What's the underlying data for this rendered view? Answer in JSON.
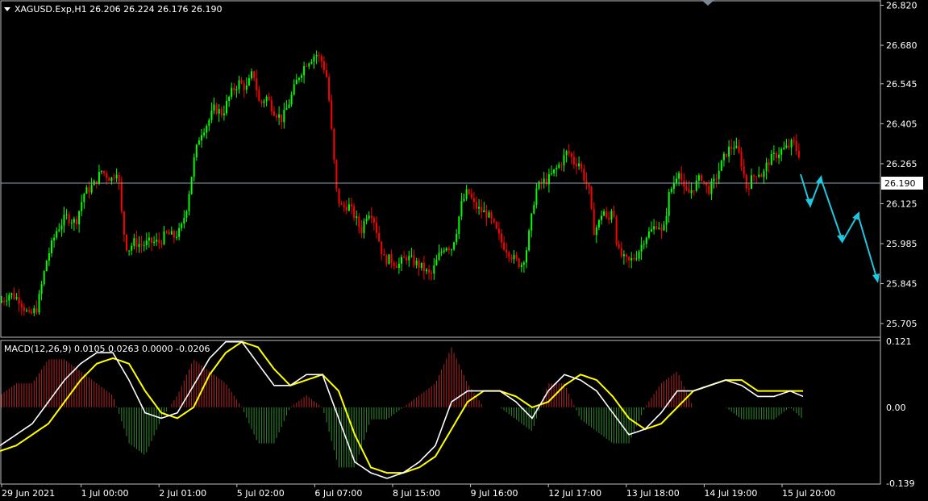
{
  "symbol_info": "XAGUSD.Exp,H1  26.206 26.224 26.176 26.190",
  "macd_info": "MACD(12,26,9) 0.0105 0.0263 0.0000 -0.0206",
  "colors": {
    "background": "#000000",
    "bull_candle": "#00ff00",
    "bear_candle": "#ff0000",
    "macd_line": "#ffffff",
    "signal_line": "#ffff00",
    "hist_positive": "#b22222",
    "hist_negative": "#2e8b2e",
    "annotation_arrow": "#1fc8e0",
    "grid_and_axes": "#c0c0c0"
  },
  "chart_data": [
    {
      "type": "candlestick",
      "title": "XAGUSD.Exp,H1",
      "ylim": [
        25.66,
        26.83
      ],
      "y_ticks": [
        "26.820",
        "26.680",
        "26.545",
        "26.405",
        "26.265",
        "26.125",
        "25.985",
        "25.845",
        "25.705"
      ],
      "current_price": "26.190",
      "x_ticks": [
        "29 Jun 2021",
        "1 Jul 00:00",
        "2 Jul 01:00",
        "5 Jul 02:00",
        "6 Jul 07:00",
        "8 Jul 15:00",
        "9 Jul 16:00",
        "12 Jul 17:00",
        "13 Jul 18:00",
        "14 Jul 19:00",
        "15 Jul 20:00"
      ],
      "close_path": [
        [
          0,
          25.78
        ],
        [
          12,
          25.81
        ],
        [
          24,
          25.79
        ],
        [
          36,
          25.73
        ],
        [
          46,
          25.76
        ],
        [
          58,
          25.93
        ],
        [
          70,
          26.03
        ],
        [
          82,
          26.08
        ],
        [
          94,
          26.06
        ],
        [
          104,
          26.16
        ],
        [
          116,
          26.19
        ],
        [
          126,
          26.24
        ],
        [
          138,
          26.21
        ],
        [
          146,
          26.25
        ],
        [
          152,
          26.05
        ],
        [
          158,
          25.96
        ],
        [
          166,
          25.99
        ],
        [
          176,
          25.98
        ],
        [
          186,
          25.99
        ],
        [
          198,
          25.99
        ],
        [
          206,
          26.02
        ],
        [
          216,
          26.01
        ],
        [
          224,
          26.03
        ],
        [
          232,
          26.12
        ],
        [
          240,
          26.27
        ],
        [
          248,
          26.37
        ],
        [
          258,
          26.41
        ],
        [
          266,
          26.46
        ],
        [
          276,
          26.44
        ],
        [
          286,
          26.51
        ],
        [
          296,
          26.55
        ],
        [
          306,
          26.53
        ],
        [
          314,
          26.59
        ],
        [
          322,
          26.47
        ],
        [
          330,
          26.5
        ],
        [
          340,
          26.45
        ],
        [
          350,
          26.42
        ],
        [
          360,
          26.49
        ],
        [
          370,
          26.57
        ],
        [
          380,
          26.62
        ],
        [
          392,
          26.65
        ],
        [
          400,
          26.62
        ],
        [
          406,
          26.56
        ],
        [
          410,
          26.42
        ],
        [
          414,
          26.28
        ],
        [
          418,
          26.15
        ],
        [
          424,
          26.11
        ],
        [
          432,
          26.12
        ],
        [
          440,
          26.08
        ],
        [
          448,
          26.03
        ],
        [
          456,
          26.1
        ],
        [
          462,
          26.09
        ],
        [
          468,
          26.02
        ],
        [
          476,
          25.93
        ],
        [
          484,
          25.93
        ],
        [
          494,
          25.91
        ],
        [
          504,
          25.94
        ],
        [
          514,
          25.92
        ],
        [
          524,
          25.9
        ],
        [
          534,
          25.87
        ],
        [
          544,
          25.94
        ],
        [
          552,
          25.98
        ],
        [
          560,
          25.97
        ],
        [
          566,
          26.03
        ],
        [
          572,
          26.12
        ],
        [
          580,
          26.17
        ],
        [
          588,
          26.12
        ],
        [
          596,
          26.1
        ],
        [
          604,
          26.09
        ],
        [
          612,
          26.05
        ],
        [
          622,
          25.99
        ],
        [
          630,
          25.96
        ],
        [
          638,
          25.93
        ],
        [
          646,
          25.91
        ],
        [
          652,
          25.95
        ],
        [
          658,
          26.05
        ],
        [
          664,
          26.17
        ],
        [
          672,
          26.2
        ],
        [
          680,
          26.21
        ],
        [
          688,
          26.24
        ],
        [
          696,
          26.27
        ],
        [
          704,
          26.31
        ],
        [
          712,
          26.27
        ],
        [
          718,
          26.27
        ],
        [
          724,
          26.22
        ],
        [
          730,
          26.18
        ],
        [
          736,
          26.03
        ],
        [
          742,
          26.05
        ],
        [
          748,
          26.11
        ],
        [
          754,
          26.05
        ],
        [
          760,
          26.13
        ],
        [
          766,
          25.96
        ],
        [
          774,
          25.93
        ],
        [
          780,
          25.92
        ],
        [
          788,
          25.94
        ],
        [
          794,
          25.97
        ],
        [
          800,
          26.01
        ],
        [
          808,
          26.03
        ],
        [
          816,
          26.06
        ],
        [
          822,
          26.01
        ],
        [
          830,
          26.16
        ],
        [
          836,
          26.2
        ],
        [
          842,
          26.25
        ],
        [
          848,
          26.17
        ],
        [
          854,
          26.16
        ],
        [
          862,
          26.19
        ],
        [
          870,
          26.22
        ],
        [
          878,
          26.17
        ],
        [
          886,
          26.2
        ],
        [
          894,
          26.26
        ],
        [
          902,
          26.31
        ],
        [
          910,
          26.33
        ],
        [
          918,
          26.29
        ],
        [
          926,
          26.18
        ],
        [
          932,
          26.21
        ],
        [
          940,
          26.24
        ],
        [
          946,
          26.22
        ],
        [
          952,
          26.27
        ],
        [
          960,
          26.29
        ],
        [
          968,
          26.31
        ],
        [
          976,
          26.32
        ],
        [
          984,
          26.34
        ],
        [
          990,
          26.3
        ]
      ]
    },
    {
      "type": "line",
      "title": "MACD(12,26,9)",
      "ylim": [
        -0.139,
        0.121
      ],
      "y_ticks": [
        "0.121",
        "0.00",
        "-0.139"
      ],
      "series": [
        {
          "name": "MACD",
          "x": [
            0,
            20,
            40,
            60,
            80,
            100,
            120,
            140,
            160,
            180,
            200,
            220,
            240,
            260,
            280,
            300,
            320,
            340,
            360,
            380,
            400,
            420,
            440,
            460,
            480,
            500,
            520,
            540,
            560,
            580,
            600,
            620,
            640,
            660,
            680,
            700,
            720,
            740,
            760,
            780,
            800,
            820,
            840,
            860,
            880,
            900,
            920,
            940,
            960,
            980,
            996
          ],
          "values": [
            -0.07,
            -0.05,
            -0.03,
            0.01,
            0.05,
            0.08,
            0.1,
            0.1,
            0.05,
            -0.01,
            -0.02,
            -0.01,
            0.04,
            0.09,
            0.12,
            0.12,
            0.08,
            0.04,
            0.04,
            0.06,
            0.06,
            -0.02,
            -0.1,
            -0.12,
            -0.13,
            -0.12,
            -0.1,
            -0.07,
            0.01,
            0.03,
            0.03,
            0.03,
            0.01,
            -0.02,
            0.03,
            0.06,
            0.05,
            0.03,
            -0.01,
            -0.05,
            -0.04,
            -0.01,
            0.03,
            0.03,
            0.04,
            0.05,
            0.04,
            0.02,
            0.02,
            0.03,
            0.02
          ]
        },
        {
          "name": "Signal",
          "x": [
            0,
            20,
            40,
            60,
            80,
            100,
            120,
            140,
            160,
            180,
            200,
            220,
            240,
            260,
            280,
            300,
            320,
            340,
            360,
            380,
            400,
            420,
            440,
            460,
            480,
            500,
            520,
            540,
            560,
            580,
            600,
            620,
            640,
            660,
            680,
            700,
            720,
            740,
            760,
            780,
            800,
            820,
            840,
            860,
            880,
            900,
            920,
            940,
            960,
            980,
            996
          ],
          "values": [
            -0.08,
            -0.07,
            -0.05,
            -0.03,
            0.01,
            0.05,
            0.08,
            0.09,
            0.08,
            0.03,
            -0.01,
            -0.02,
            0.0,
            0.06,
            0.1,
            0.12,
            0.11,
            0.07,
            0.04,
            0.05,
            0.06,
            0.03,
            -0.05,
            -0.11,
            -0.12,
            -0.12,
            -0.11,
            -0.09,
            -0.04,
            0.01,
            0.03,
            0.03,
            0.02,
            -0.0,
            0.01,
            0.04,
            0.06,
            0.05,
            0.02,
            -0.02,
            -0.04,
            -0.03,
            0.0,
            0.03,
            0.04,
            0.05,
            0.05,
            0.03,
            0.03,
            0.03,
            0.03
          ]
        }
      ]
    }
  ]
}
